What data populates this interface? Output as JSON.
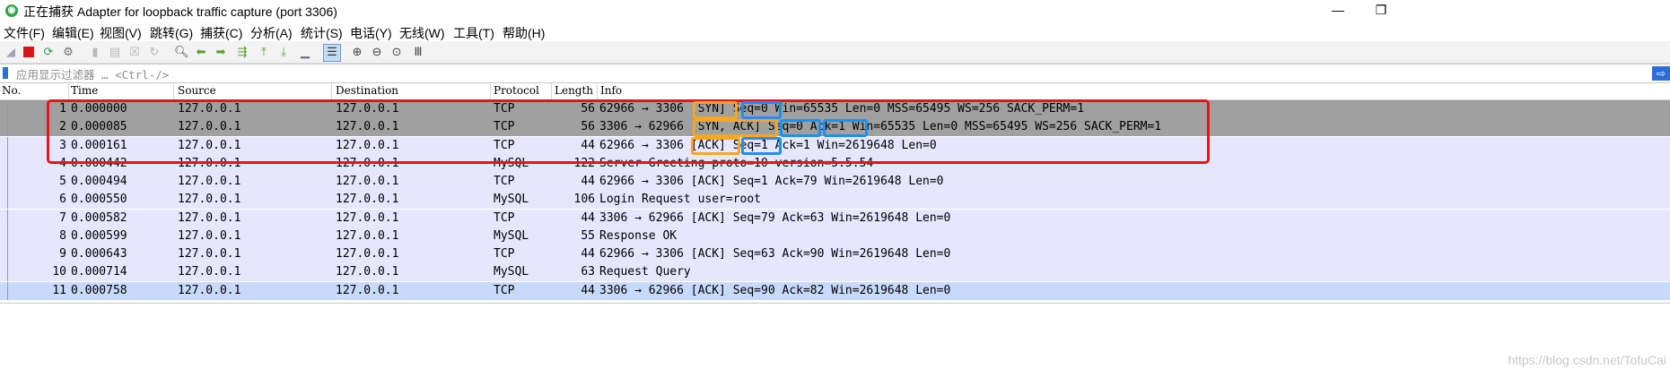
{
  "window": {
    "title": "正在捕获 Adapter for loopback traffic capture (port 3306)",
    "minimize": "—",
    "restore": "❐"
  },
  "menu": [
    "文件(F)",
    "编辑(E)",
    "视图(V)",
    "跳转(G)",
    "捕获(C)",
    "分析(A)",
    "统计(S)",
    "电话(Y)",
    "无线(W)",
    "工具(T)",
    "帮助(H)"
  ],
  "filter": {
    "placeholder": "应用显示过滤器 … <Ctrl-/>",
    "apply_icon": "arrow-right-icon"
  },
  "columns": [
    "No.",
    "Time",
    "Source",
    "Destination",
    "Protocol",
    "Length",
    "Info"
  ],
  "rows": [
    {
      "no": "1",
      "time": "0.000000",
      "src": "127.0.0.1",
      "dst": "127.0.0.1",
      "proto": "TCP",
      "len": "56",
      "info": "62966 → 3306 [SYN] Seq=0 Win=65535 Len=0 MSS=65495 WS=256 SACK_PERM=1",
      "bg": "#a0a0a0"
    },
    {
      "no": "2",
      "time": "0.000085",
      "src": "127.0.0.1",
      "dst": "127.0.0.1",
      "proto": "TCP",
      "len": "56",
      "info": "3306 → 62966 [SYN, ACK] Seq=0 Ack=1 Win=65535 Len=0 MSS=65495 WS=256 SACK_PERM=1",
      "bg": "#a0a0a0"
    },
    {
      "no": "3",
      "time": "0.000161",
      "src": "127.0.0.1",
      "dst": "127.0.0.1",
      "proto": "TCP",
      "len": "44",
      "info": "62966 → 3306 [ACK] Seq=1 Ack=1 Win=2619648 Len=0",
      "bg": "#e7e6ff"
    },
    {
      "no": "4",
      "time": "0.000442",
      "src": "127.0.0.1",
      "dst": "127.0.0.1",
      "proto": "MySQL",
      "len": "122",
      "info": "Server Greeting proto=10 version=5.5.54",
      "bg": "#e7e6ff"
    },
    {
      "no": "5",
      "time": "0.000494",
      "src": "127.0.0.1",
      "dst": "127.0.0.1",
      "proto": "TCP",
      "len": "44",
      "info": "62966 → 3306 [ACK] Seq=1 Ack=79 Win=2619648 Len=0",
      "bg": "#e7e6ff"
    },
    {
      "no": "6",
      "time": "0.000550",
      "src": "127.0.0.1",
      "dst": "127.0.0.1",
      "proto": "MySQL",
      "len": "106",
      "info": "Login Request user=root",
      "bg": "#e7e6ff"
    },
    {
      "no": "7",
      "time": "0.000582",
      "src": "127.0.0.1",
      "dst": "127.0.0.1",
      "proto": "TCP",
      "len": "44",
      "info": "3306 → 62966 [ACK] Seq=79 Ack=63 Win=2619648 Len=0",
      "bg": "#e7e6ff"
    },
    {
      "no": "8",
      "time": "0.000599",
      "src": "127.0.0.1",
      "dst": "127.0.0.1",
      "proto": "MySQL",
      "len": "55",
      "info": "Response OK",
      "bg": "#e7e6ff"
    },
    {
      "no": "9",
      "time": "0.000643",
      "src": "127.0.0.1",
      "dst": "127.0.0.1",
      "proto": "TCP",
      "len": "44",
      "info": "62966 → 3306 [ACK] Seq=63 Ack=90 Win=2619648 Len=0",
      "bg": "#e7e6ff"
    },
    {
      "no": "10",
      "time": "0.000714",
      "src": "127.0.0.1",
      "dst": "127.0.0.1",
      "proto": "MySQL",
      "len": "63",
      "info": "Request Query",
      "bg": "#e7e6ff"
    },
    {
      "no": "11",
      "time": "0.000758",
      "src": "127.0.0.1",
      "dst": "127.0.0.1",
      "proto": "TCP",
      "len": "44",
      "info": "3306 → 62966 [ACK] Seq=90 Ack=82 Win=2619648 Len=0",
      "bg": "#c8dafc"
    }
  ],
  "toolbar_icons": [
    "shark-fin-start-icon",
    "stop-capture-icon",
    "restart-capture-icon",
    "capture-options-icon",
    "open-file-icon",
    "save-file-icon",
    "close-file-icon",
    "reload-icon",
    "find-icon",
    "go-back-icon",
    "go-forward-icon",
    "go-to-packet-icon",
    "go-first-icon",
    "go-last-icon",
    "autoscroll-icon",
    "colorize-icon",
    "zoom-in-icon",
    "zoom-out-icon",
    "zoom-normal-icon",
    "resize-columns-icon"
  ],
  "annotation_colors": {
    "red": "#e8141b",
    "orange": "#f5a623",
    "blue": "#1f8ff0"
  },
  "watermark": "https://blog.csdn.net/TofuCai"
}
